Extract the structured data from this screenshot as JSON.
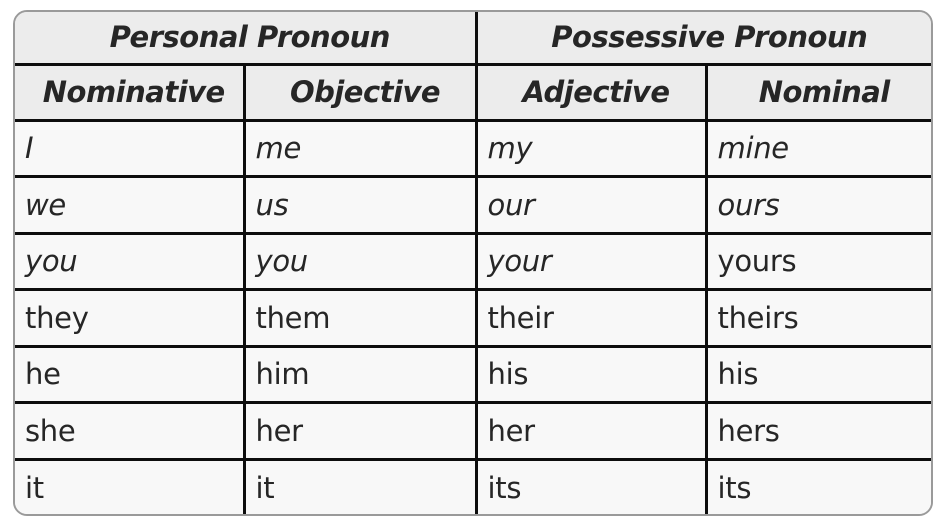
{
  "table": {
    "group_headers": [
      {
        "label": "Personal Pronoun",
        "span": 2
      },
      {
        "label": "Possessive Pronoun",
        "span": 2
      }
    ],
    "columns": [
      "Nominative",
      "Objective",
      "Adjective",
      "Nominal"
    ],
    "rows": [
      {
        "italic": true,
        "cells": [
          "I",
          "me",
          "my",
          "mine"
        ]
      },
      {
        "italic": true,
        "cells": [
          "we",
          "us",
          "our",
          "ours"
        ]
      },
      {
        "italic": true,
        "cells": [
          "you",
          "you",
          "your",
          "yours"
        ],
        "italic_cells": [
          true,
          true,
          true,
          false
        ]
      },
      {
        "italic": false,
        "cells": [
          "they",
          "them",
          "their",
          "theirs"
        ]
      },
      {
        "italic": false,
        "cells": [
          "he",
          "him",
          "his",
          "his"
        ]
      },
      {
        "italic": false,
        "cells": [
          "she",
          "her",
          "her",
          "hers"
        ]
      },
      {
        "italic": false,
        "cells": [
          "it",
          "it",
          "its",
          "its"
        ]
      }
    ]
  },
  "colors": {
    "header_bg": "#ececec",
    "cell_bg": "#f8f8f8",
    "grid_line": "#0d0d0d",
    "frame_border": "#9a9a9a",
    "text": "#262626"
  }
}
